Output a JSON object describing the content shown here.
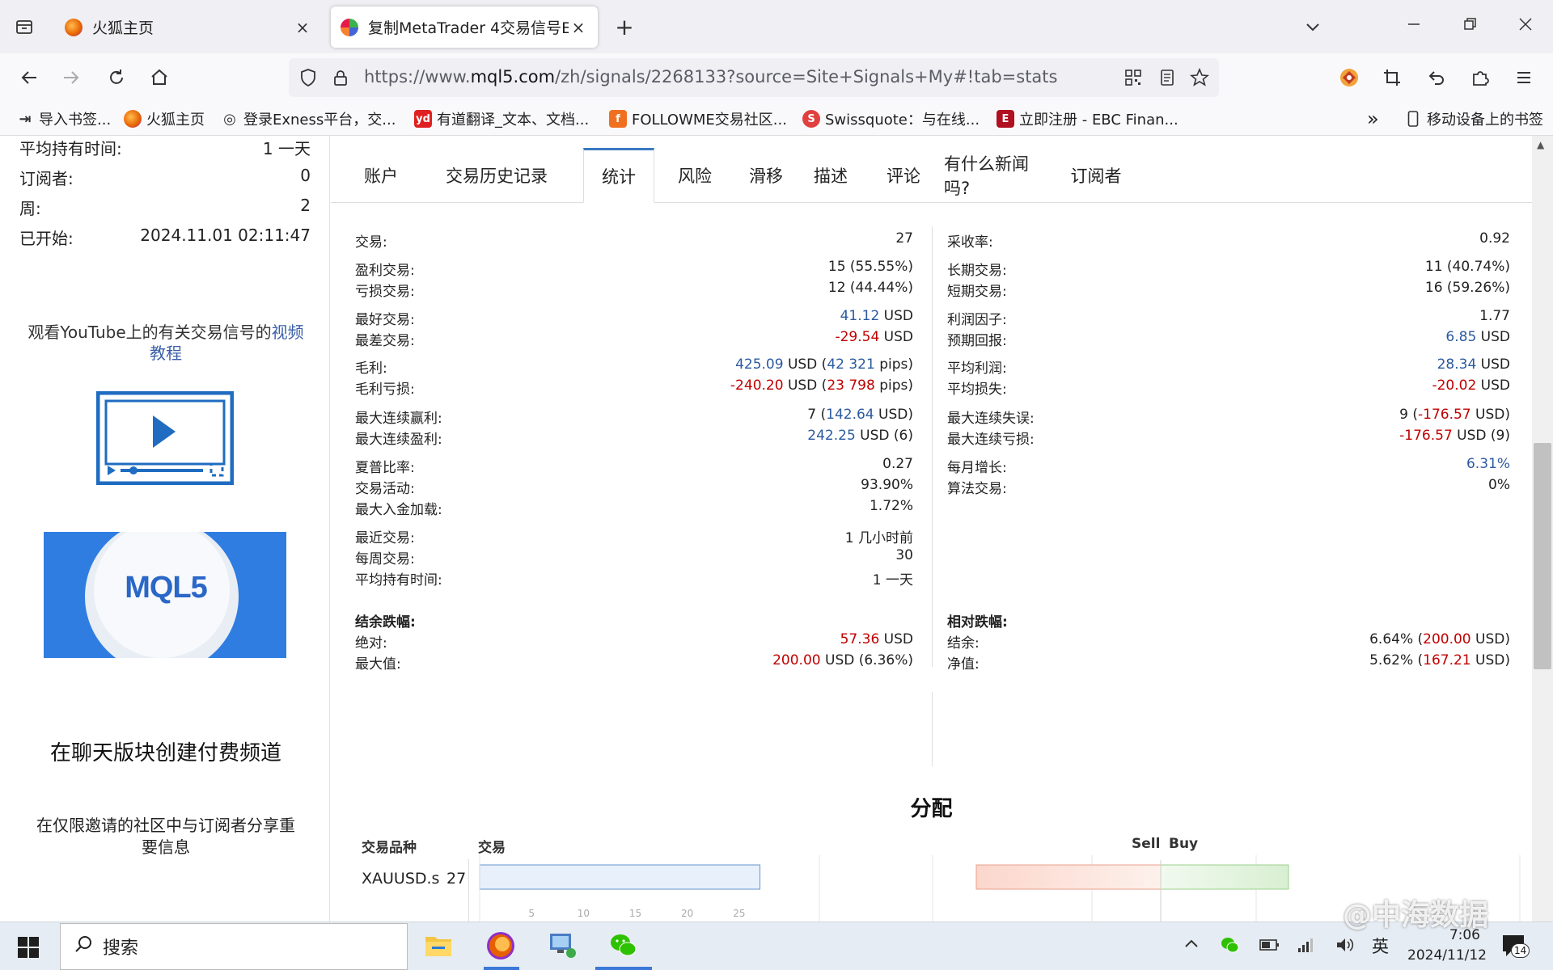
{
  "browser": {
    "tabs": [
      {
        "title": "火狐主页",
        "close": "×"
      },
      {
        "title": "复制MetaTrader 4交易信号EBC",
        "close": "×"
      }
    ],
    "new_tab": "+",
    "url_prefix": "https://www.",
    "url_domain": "mql5.com",
    "url_rest": "/zh/signals/2268133?source=Site+Signals+My#!tab=stats",
    "bookmarks": [
      {
        "label": "导入书签...",
        "icon": "import-icon",
        "color": "#555555"
      },
      {
        "label": "火狐主页",
        "icon": "firefox-icon",
        "color": "#e66000"
      },
      {
        "label": "登录Exness平台，交...",
        "icon": "globe-icon",
        "color": "#555555"
      },
      {
        "label": "有道翻译_文本、文档...",
        "icon": "youdao-icon",
        "color": "#e02020"
      },
      {
        "label": "FOLLOWME交易社区...",
        "icon": "followme-icon",
        "color": "#f07020"
      },
      {
        "label": "Swissquote：与在线...",
        "icon": "swissquote-icon",
        "color": "#e04040"
      },
      {
        "label": "立即注册 - EBC Finan...",
        "icon": "ebc-icon",
        "color": "#b01020"
      }
    ],
    "bookmarks_overflow": "»",
    "mobile_bookmarks": "移动设备上的书签"
  },
  "left": {
    "stats": [
      {
        "k": "平均持有时间:",
        "v": "1 一天"
      },
      {
        "k": "订阅者:",
        "v": "0"
      },
      {
        "k": "周:",
        "v": "2"
      },
      {
        "k": "已开始:",
        "v": "2024.11.01 02:11:47"
      }
    ],
    "yt_text": "观看YouTube上的有关交易信号的",
    "yt_link": "视频教程",
    "banner_text": "MQL5",
    "channel_title": "在聊天版块创建付费频道",
    "channel_desc": "在仅限邀请的社区中与订阅者分享重要信息"
  },
  "page_tabs": [
    "账户",
    "交易历史记录",
    "统计",
    "风险",
    "滑移",
    "描述",
    "评论",
    "有什么新闻吗?",
    "订阅者"
  ],
  "stats_left": [
    {
      "k": "交易:",
      "v": [
        {
          "t": "27"
        }
      ]
    },
    {
      "k": "盈利交易:",
      "v": [
        {
          "t": "15 (55.55%)"
        }
      ]
    },
    {
      "k": "亏损交易:",
      "v": [
        {
          "t": "12 (44.44%)"
        }
      ]
    },
    {
      "k": "最好交易:",
      "v": [
        {
          "t": "41.12",
          "c": "pos"
        },
        {
          "t": " USD"
        }
      ]
    },
    {
      "k": "最差交易:",
      "v": [
        {
          "t": "-29.54",
          "c": "neg"
        },
        {
          "t": " USD"
        }
      ]
    },
    {
      "k": "毛利:",
      "v": [
        {
          "t": "425.09",
          "c": "pos"
        },
        {
          "t": " USD ("
        },
        {
          "t": "42 321",
          "c": "pos"
        },
        {
          "t": " pips)"
        }
      ]
    },
    {
      "k": "毛利亏损:",
      "v": [
        {
          "t": "-240.20",
          "c": "neg"
        },
        {
          "t": " USD ("
        },
        {
          "t": "23 798",
          "c": "neg"
        },
        {
          "t": " pips)"
        }
      ]
    },
    {
      "k": "最大连续赢利:",
      "v": [
        {
          "t": "7 ("
        },
        {
          "t": "142.64",
          "c": "pos"
        },
        {
          "t": " USD)"
        }
      ]
    },
    {
      "k": "最大连续盈利:",
      "v": [
        {
          "t": "242.25",
          "c": "pos"
        },
        {
          "t": " USD (6)"
        }
      ]
    },
    {
      "k": "夏普比率:",
      "v": [
        {
          "t": "0.27"
        }
      ]
    },
    {
      "k": "交易活动:",
      "v": [
        {
          "t": "93.90%"
        }
      ]
    },
    {
      "k": "最大入金加载:",
      "v": [
        {
          "t": "1.72%"
        }
      ]
    },
    {
      "k": "最近交易:",
      "v": [
        {
          "t": "1 几小时前"
        }
      ]
    },
    {
      "k": "每周交易:",
      "v": [
        {
          "t": "30"
        }
      ]
    },
    {
      "k": "平均持有时间:",
      "v": [
        {
          "t": "1 一天"
        }
      ]
    }
  ],
  "stats_right": [
    {
      "k": "采收率:",
      "v": [
        {
          "t": "0.92"
        }
      ]
    },
    {
      "k": "长期交易:",
      "v": [
        {
          "t": "11 (40.74%)"
        }
      ]
    },
    {
      "k": "短期交易:",
      "v": [
        {
          "t": "16 (59.26%)"
        }
      ]
    },
    {
      "k": "利润因子:",
      "v": [
        {
          "t": "1.77"
        }
      ]
    },
    {
      "k": "预期回报:",
      "v": [
        {
          "t": "6.85",
          "c": "pos"
        },
        {
          "t": " USD"
        }
      ]
    },
    {
      "k": "平均利润:",
      "v": [
        {
          "t": "28.34",
          "c": "pos"
        },
        {
          "t": " USD"
        }
      ]
    },
    {
      "k": "平均损失:",
      "v": [
        {
          "t": "-20.02",
          "c": "neg"
        },
        {
          "t": " USD"
        }
      ]
    },
    {
      "k": "最大连续失误:",
      "v": [
        {
          "t": "9 ("
        },
        {
          "t": "-176.57",
          "c": "neg"
        },
        {
          "t": " USD)"
        }
      ]
    },
    {
      "k": "最大连续亏损:",
      "v": [
        {
          "t": "-176.57",
          "c": "neg"
        },
        {
          "t": " USD (9)"
        }
      ]
    },
    {
      "k": "每月增长:",
      "v": [
        {
          "t": "6.31%",
          "c": "pos"
        }
      ]
    },
    {
      "k": "算法交易:",
      "v": [
        {
          "t": "0%"
        }
      ]
    }
  ],
  "drawdown_left": {
    "title": "结余跌幅:",
    "rows": [
      {
        "k": "绝对:",
        "v": [
          {
            "t": "57.36",
            "c": "neg"
          },
          {
            "t": " USD"
          }
        ]
      },
      {
        "k": "最大值:",
        "v": [
          {
            "t": "200.00",
            "c": "neg"
          },
          {
            "t": " USD (6.36%)"
          }
        ]
      }
    ]
  },
  "drawdown_right": {
    "title": "相对跌幅:",
    "rows": [
      {
        "k": "结余:",
        "v": [
          {
            "t": "6.64% ("
          },
          {
            "t": "200.00",
            "c": "neg"
          },
          {
            "t": " USD)"
          }
        ]
      },
      {
        "k": "净值:",
        "v": [
          {
            "t": "5.62% ("
          },
          {
            "t": "167.21",
            "c": "neg"
          },
          {
            "t": " USD)"
          }
        ]
      }
    ]
  },
  "distribution": {
    "title": "分配",
    "col_symbol": "交易品种",
    "col_trades": "交易",
    "col_sell": "Sell",
    "col_buy": "Buy",
    "symbol": "XAUUSD.s",
    "count": "27",
    "trades_axis": [
      "5",
      "10",
      "15",
      "20",
      "25"
    ],
    "axis_max": 30,
    "bar_value": 27
  },
  "taskbar": {
    "search": "搜索",
    "ime": "英",
    "time": "7:06",
    "date": "2024/11/12",
    "notifications": "14",
    "watermark": "@中海数据"
  }
}
